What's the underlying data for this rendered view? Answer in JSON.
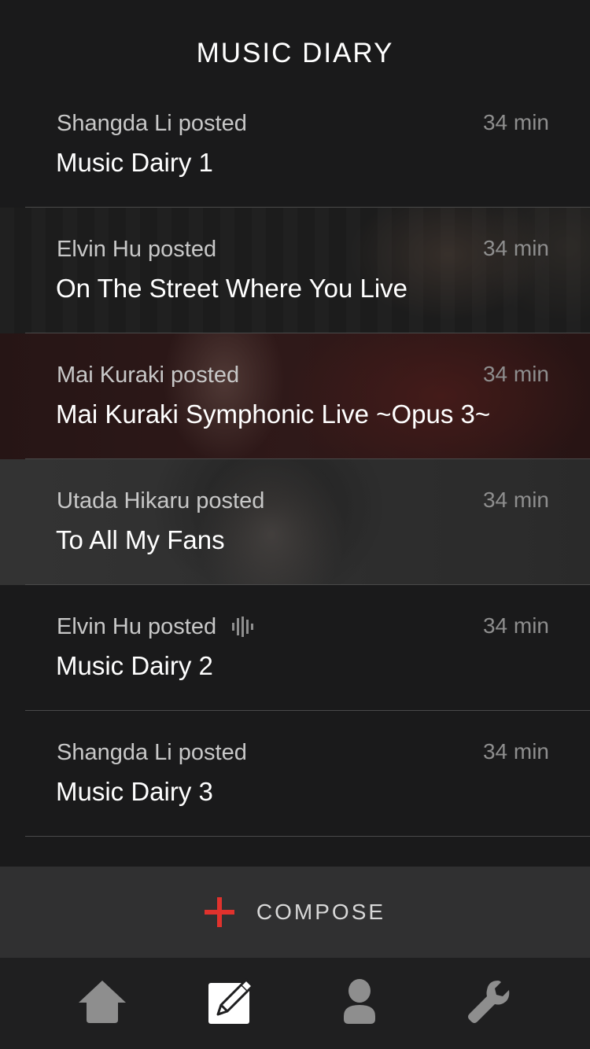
{
  "header": {
    "title": "MUSIC DIARY"
  },
  "posts": [
    {
      "author": "Shangda Li posted",
      "time": "34 min",
      "title": "Music Dairy 1",
      "has_audio": false
    },
    {
      "author": "Elvin Hu posted",
      "time": "34 min",
      "title": "On The Street Where You Live",
      "has_audio": false
    },
    {
      "author": "Mai Kuraki posted",
      "time": "34 min",
      "title": "Mai Kuraki Symphonic Live ~Opus 3~",
      "has_audio": false
    },
    {
      "author": "Utada Hikaru posted",
      "time": "34 min",
      "title": "To All My Fans",
      "has_audio": false
    },
    {
      "author": "Elvin Hu posted",
      "time": "34 min",
      "title": "Music Dairy 2",
      "has_audio": true
    },
    {
      "author": "Shangda Li posted",
      "time": "34 min",
      "title": "Music Dairy 3",
      "has_audio": false
    }
  ],
  "compose": {
    "label": "COMPOSE",
    "icon": "plus-icon",
    "accent": "#e0322d"
  },
  "tabbar": {
    "tabs": [
      {
        "icon": "home-icon",
        "active": false
      },
      {
        "icon": "compose-icon",
        "active": true
      },
      {
        "icon": "profile-icon",
        "active": false
      },
      {
        "icon": "wrench-icon",
        "active": false
      }
    ]
  },
  "colors": {
    "background": "#1a1a1b",
    "compose_bar": "#303031",
    "tabbar": "#1f1f20",
    "icon": "#8e8e8e"
  }
}
